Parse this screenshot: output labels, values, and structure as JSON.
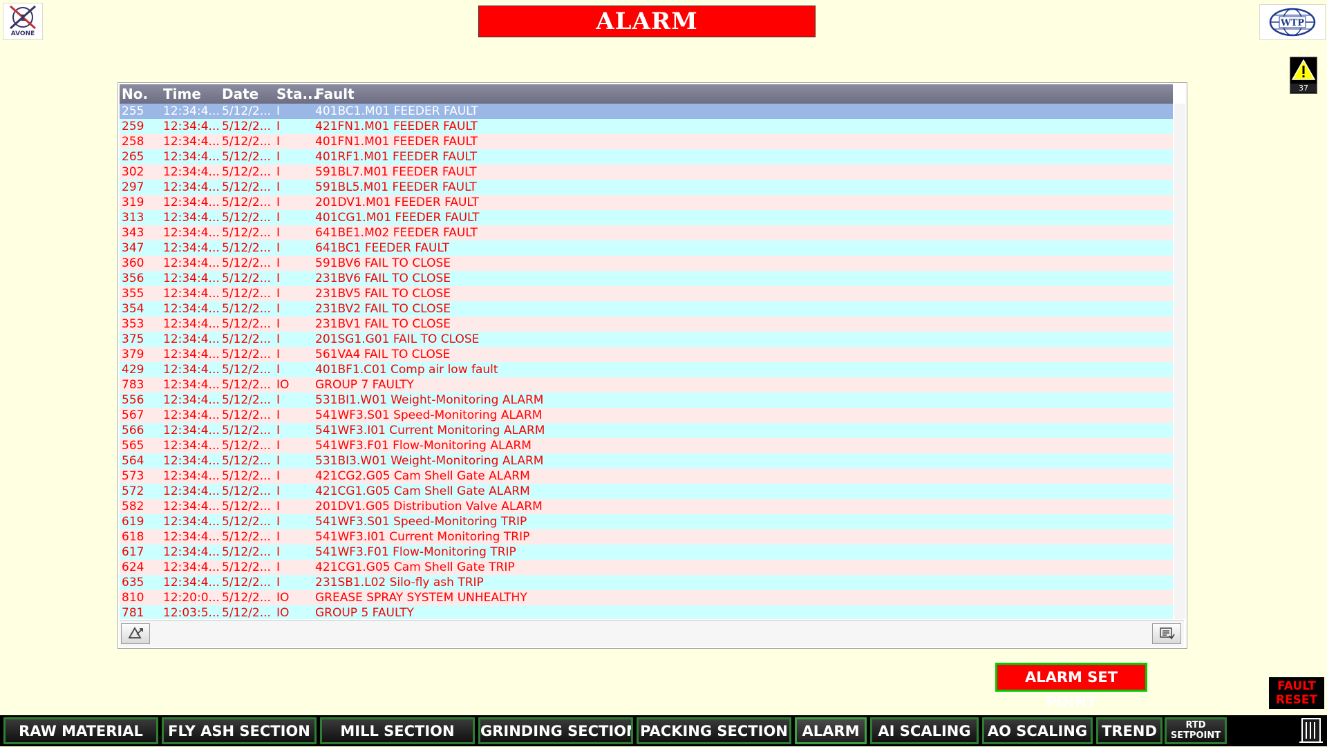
{
  "logo_left_text": "AVONE",
  "logo_right_text": "WTP",
  "title": "ALARM",
  "warning_count": "37",
  "alarm_table": {
    "columns": [
      "No.",
      "Time",
      "Date",
      "Sta...",
      "Fault"
    ],
    "rows": [
      [
        "255",
        "12:34:4...",
        "5/12/2...",
        "I",
        "401BC1.M01 FEEDER FAULT"
      ],
      [
        "259",
        "12:34:4...",
        "5/12/2...",
        "I",
        "421FN1.M01 FEEDER FAULT"
      ],
      [
        "258",
        "12:34:4...",
        "5/12/2...",
        "I",
        "401FN1.M01 FEEDER FAULT"
      ],
      [
        "265",
        "12:34:4...",
        "5/12/2...",
        "I",
        "401RF1.M01 FEEDER FAULT"
      ],
      [
        "302",
        "12:34:4...",
        "5/12/2...",
        "I",
        "591BL7.M01 FEEDER FAULT"
      ],
      [
        "297",
        "12:34:4...",
        "5/12/2...",
        "I",
        "591BL5.M01 FEEDER FAULT"
      ],
      [
        "319",
        "12:34:4...",
        "5/12/2...",
        "I",
        "201DV1.M01 FEEDER FAULT"
      ],
      [
        "313",
        "12:34:4...",
        "5/12/2...",
        "I",
        "401CG1.M01 FEEDER FAULT"
      ],
      [
        "343",
        "12:34:4...",
        "5/12/2...",
        "I",
        "641BE1.M02 FEEDER FAULT"
      ],
      [
        "347",
        "12:34:4...",
        "5/12/2...",
        "I",
        "641BC1 FEEDER FAULT"
      ],
      [
        "360",
        "12:34:4...",
        "5/12/2...",
        "I",
        "591BV6 FAIL TO CLOSE"
      ],
      [
        "356",
        "12:34:4...",
        "5/12/2...",
        "I",
        "231BV6 FAIL TO CLOSE"
      ],
      [
        "355",
        "12:34:4...",
        "5/12/2...",
        "I",
        "231BV5 FAIL TO CLOSE"
      ],
      [
        "354",
        "12:34:4...",
        "5/12/2...",
        "I",
        "231BV2 FAIL TO CLOSE"
      ],
      [
        "353",
        "12:34:4...",
        "5/12/2...",
        "I",
        "231BV1 FAIL TO CLOSE"
      ],
      [
        "375",
        "12:34:4...",
        "5/12/2...",
        "I",
        "201SG1.G01 FAIL TO CLOSE"
      ],
      [
        "379",
        "12:34:4...",
        "5/12/2...",
        "I",
        "561VA4 FAIL TO CLOSE"
      ],
      [
        "429",
        "12:34:4...",
        "5/12/2...",
        "I",
        "401BF1.C01 Comp air low fault"
      ],
      [
        "783",
        "12:34:4...",
        "5/12/2...",
        "IO",
        "GROUP 7 FAULTY"
      ],
      [
        "556",
        "12:34:4...",
        "5/12/2...",
        "I",
        "531BI1.W01 Weight-Monitoring ALARM"
      ],
      [
        "567",
        "12:34:4...",
        "5/12/2...",
        "I",
        "541WF3.S01 Speed-Monitoring ALARM"
      ],
      [
        "566",
        "12:34:4...",
        "5/12/2...",
        "I",
        "541WF3.I01 Current Monitoring ALARM"
      ],
      [
        "565",
        "12:34:4...",
        "5/12/2...",
        "I",
        "541WF3.F01 Flow-Monitoring ALARM"
      ],
      [
        "564",
        "12:34:4...",
        "5/12/2...",
        "I",
        "531BI3.W01 Weight-Monitoring ALARM"
      ],
      [
        "573",
        "12:34:4...",
        "5/12/2...",
        "I",
        "421CG2.G05 Cam Shell Gate ALARM"
      ],
      [
        "572",
        "12:34:4...",
        "5/12/2...",
        "I",
        "421CG1.G05 Cam Shell Gate ALARM"
      ],
      [
        "582",
        "12:34:4...",
        "5/12/2...",
        "I",
        "201DV1.G05 Distribution Valve ALARM"
      ],
      [
        "619",
        "12:34:4...",
        "5/12/2...",
        "I",
        "541WF3.S01 Speed-Monitoring TRIP"
      ],
      [
        "618",
        "12:34:4...",
        "5/12/2...",
        "I",
        "541WF3.I01 Current Monitoring TRIP"
      ],
      [
        "617",
        "12:34:4...",
        "5/12/2...",
        "I",
        "541WF3.F01 Flow-Monitoring TRIP"
      ],
      [
        "624",
        "12:34:4...",
        "5/12/2...",
        "I",
        "421CG1.G05 Cam Shell Gate TRIP"
      ],
      [
        "635",
        "12:34:4...",
        "5/12/2...",
        "I",
        "231SB1.L02 Silo-fly ash TRIP"
      ],
      [
        "810",
        "12:20:0...",
        "5/12/2...",
        "IO",
        "GREASE SPRAY SYSTEM UNHEALTHY"
      ],
      [
        "781",
        "12:03:5...",
        "5/12/2...",
        "IO",
        "GROUP 5 FAULTY"
      ]
    ]
  },
  "alarm_set_point_label": "ALARM SET POINT",
  "fault_reset_label": "FAULT RESET",
  "nav": [
    "RAW MATERIAL",
    "FLY ASH SECTION",
    "MILL SECTION",
    "GRINDING SECTION",
    "PACKING SECTION",
    "ALARM",
    "AI SCALING",
    "AO SCALING",
    "TREND"
  ],
  "nav_rtd_line1": "RTD",
  "nav_rtd_line2": "SETPOINT",
  "colors": {
    "background": "#FFFFE1",
    "title_bg": "#FF0000",
    "alarm_text": "#FF0000",
    "row_even": "#FFEAEA",
    "row_odd": "#CCFFFF",
    "row_selected": "#9BB7E6",
    "nav_border": "#2E7D32"
  },
  "icons": {
    "warning": "warning-triangle-icon",
    "acknowledge": "acknowledge-icon",
    "alarm_list": "alarm-list-icon",
    "exit": "exit-door-icon"
  }
}
